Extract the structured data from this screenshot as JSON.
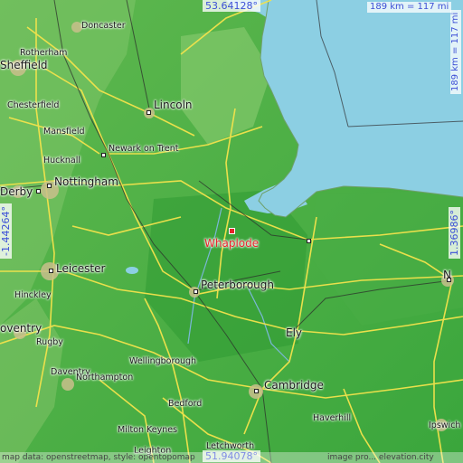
{
  "map": {
    "highlight": "Whaplode",
    "coords": {
      "top_lat": "53.64128°",
      "bottom_lat": "51.94078°",
      "left_lon": "-1.44264°",
      "right_lon": "1.36986°"
    },
    "scale": {
      "horizontal": "189 km = 117 mi",
      "vertical": "189 km = 117 mi"
    },
    "attribution_left": "map data: openstreetmap, style: opentopomap",
    "attribution_right": "image pro... elevation.city",
    "cities": [
      {
        "id": "doncaster",
        "name": "Doncaster"
      },
      {
        "id": "rotherham",
        "name": "Rotherham"
      },
      {
        "id": "sheffield",
        "name": "Sheffield"
      },
      {
        "id": "chesterfield",
        "name": "Chesterfield"
      },
      {
        "id": "mansfield",
        "name": "Mansfield"
      },
      {
        "id": "lincoln",
        "name": "Lincoln"
      },
      {
        "id": "newark",
        "name": "Newark on Trent"
      },
      {
        "id": "hucknall",
        "name": "Hucknall"
      },
      {
        "id": "nottingham",
        "name": "Nottingham"
      },
      {
        "id": "derby",
        "name": "Derby"
      },
      {
        "id": "leicester",
        "name": "Leicester"
      },
      {
        "id": "hinckley",
        "name": "Hinckley"
      },
      {
        "id": "coventry",
        "name": "oventry"
      },
      {
        "id": "rugby",
        "name": "Rugby"
      },
      {
        "id": "daventry",
        "name": "Daventry"
      },
      {
        "id": "northampton",
        "name": "Northampton"
      },
      {
        "id": "wellingborough",
        "name": "Wellingborough"
      },
      {
        "id": "peterborough",
        "name": "Peterborough"
      },
      {
        "id": "ely",
        "name": "Ely"
      },
      {
        "id": "cambridge",
        "name": "Cambridge"
      },
      {
        "id": "bedford",
        "name": "Bedford"
      },
      {
        "id": "miltonkeynes",
        "name": "Milton Keynes"
      },
      {
        "id": "leighton",
        "name": "Leighton"
      },
      {
        "id": "letchworth",
        "name": "Letchworth"
      },
      {
        "id": "haverhill",
        "name": "Haverhill"
      },
      {
        "id": "ipswich",
        "name": "Ipswich"
      },
      {
        "id": "norwich",
        "name": "N"
      }
    ]
  }
}
